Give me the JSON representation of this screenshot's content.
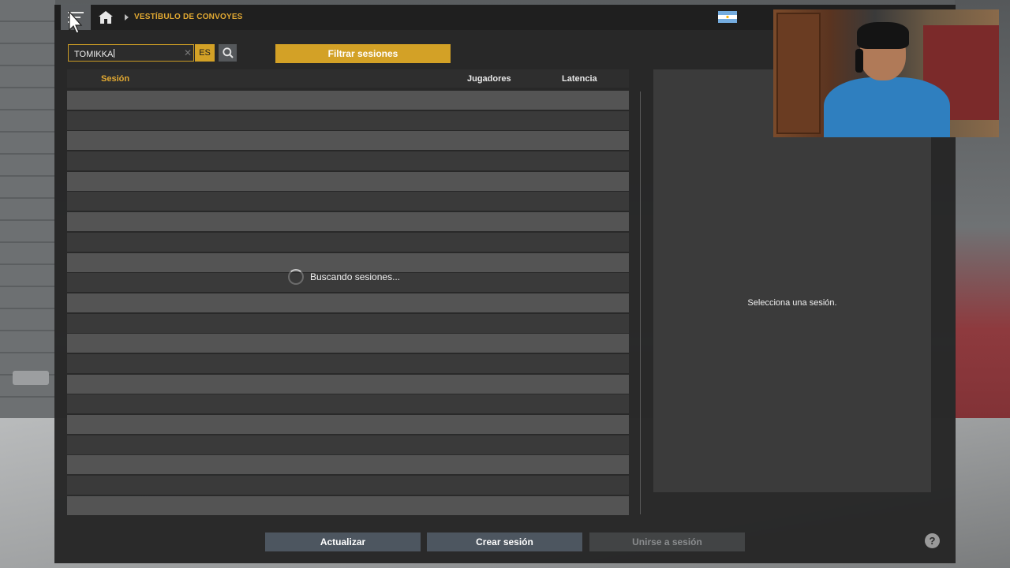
{
  "topbar": {
    "breadcrumb": "VESTÍBULO DE CONVOYES",
    "flag": "argentina-flag-icon"
  },
  "search": {
    "value": "TOMIKKA",
    "language": "ES",
    "filter_label": "Filtrar sesiones"
  },
  "table": {
    "columns": {
      "session": "Sesión",
      "players": "Jugadores",
      "latency": "Latencia"
    },
    "loading_text": "Buscando sesiones..."
  },
  "details": {
    "empty_text": "Selecciona una sesión."
  },
  "footer": {
    "refresh_label": "Actualizar",
    "create_label": "Crear sesión",
    "join_label": "Unirse a sesión",
    "help_label": "?"
  },
  "colors": {
    "accent": "#d3a126",
    "panel": "#262626",
    "button": "#4d5660"
  }
}
